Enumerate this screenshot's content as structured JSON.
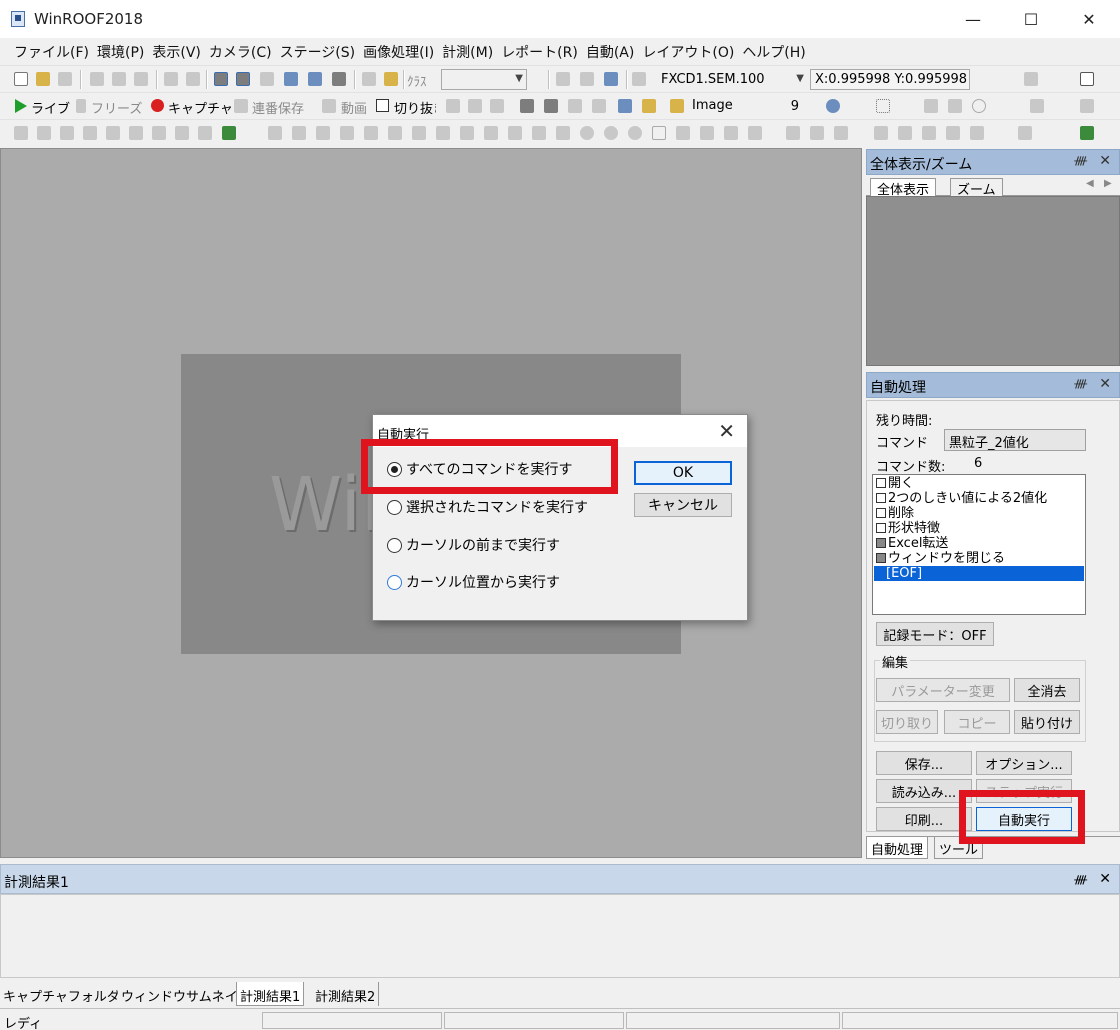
{
  "window": {
    "title": "WinROOF2018",
    "min_glyph": "—",
    "max_glyph": "☐",
    "close_glyph": "✕"
  },
  "menu": [
    "ファイル(F)",
    "環境(P)",
    "表示(V)",
    "カメラ(C)",
    "ステージ(S)",
    "画像処理(I)",
    "計測(M)",
    "レポート(R)",
    "自動(A)",
    "レイアウト(O)",
    "ヘルプ(H)"
  ],
  "toolbar1": {
    "class_label": "ｸﾗｽ",
    "class_value": "",
    "calibration_value": "FXCD1.SEM.100",
    "coordinates": "X:0.995998  Y:0.995998"
  },
  "toolbar2": {
    "live": "ライブ",
    "freeze": "フリーズ",
    "capture": "キャプチャ",
    "continuous_save": "連番保存",
    "movie": "動画",
    "crop": "切り抜き",
    "image_label": "Image",
    "image_number": "9"
  },
  "canvas": {
    "watermark": "WinROOF"
  },
  "panels": {
    "overview": {
      "title": "全体表示/ズーム",
      "tabs": [
        "全体表示",
        "ズーム"
      ],
      "pin": "📌",
      "close": "✕"
    },
    "auto": {
      "title": "自動処理",
      "remaining_time_label": "残り時間:",
      "command_label": "コマンド",
      "command_value": "黒粒子_2値化",
      "command_count_label": "コマンド数:",
      "command_count": "6",
      "commands": [
        "開く",
        "2つのしきい値による2値化",
        "削除",
        "形状特徴",
        "Excel転送",
        "ウィンドウを閉じる",
        "[EOF]"
      ],
      "record_mode": "記録モード：OFF",
      "edit_group": "編集",
      "buttons": {
        "param_change": "パラメーター変更",
        "clear_all": "全消去",
        "cut": "切り取り",
        "copy": "コピー",
        "paste": "貼り付け",
        "save": "保存...",
        "options": "オプション...",
        "load": "読み込み...",
        "step_run": "ステップ実行",
        "print": "印刷...",
        "auto_run": "自動実行"
      },
      "bottom_tabs": [
        "自動処理",
        "ツール"
      ]
    },
    "results": {
      "title": "計測結果1"
    }
  },
  "bottom_tabs": [
    "キャプチャフォルダー",
    "ウィンドウサムネイル",
    "計測結果1",
    "計測結果2"
  ],
  "status": {
    "text": "レディ"
  },
  "dialog": {
    "title": "自動実行",
    "options": [
      "すべてのコマンドを実行す",
      "選択されたコマンドを実行す",
      "カーソルの前まで実行す",
      "カーソル位置から実行す"
    ],
    "ok": "OK",
    "cancel": "キャンセル"
  },
  "colors": {
    "highlight": "#e0141e",
    "selection": "#0a64d8",
    "panel_header": "#a4bcd9"
  }
}
